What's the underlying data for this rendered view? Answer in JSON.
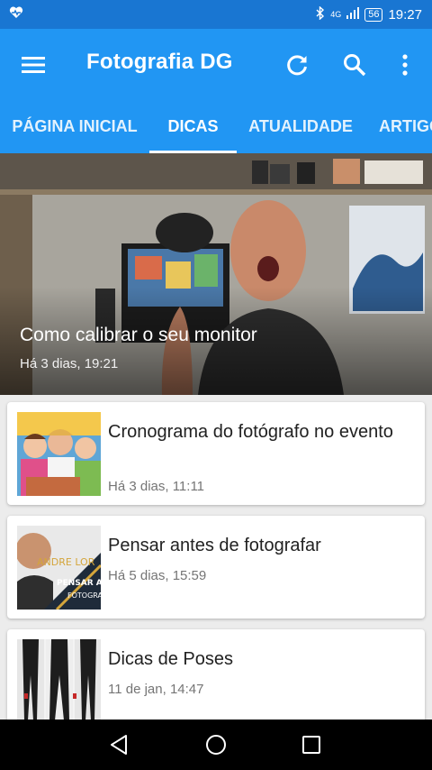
{
  "status_bar": {
    "network": "4G",
    "battery": "56",
    "time": "19:27"
  },
  "app_bar": {
    "title": "Fotografia DG"
  },
  "tabs": [
    {
      "label": "PÁGINA INICIAL",
      "active": false
    },
    {
      "label": "DICAS",
      "active": true
    },
    {
      "label": "ATUALIDADE",
      "active": false
    },
    {
      "label": "ARTIGOS",
      "active": false
    }
  ],
  "featured": {
    "title": "Como calibrar o seu monitor",
    "date": "Há 3 dias, 19:21"
  },
  "articles": [
    {
      "title": "Cronograma do fotógrafo no evento",
      "date": "Há 3 dias, 11:11"
    },
    {
      "title": "Pensar antes de fotografar",
      "date": "Há 5 dias, 15:59"
    },
    {
      "title": "Dicas de Poses",
      "date": "11 de jan, 14:47"
    }
  ],
  "thumb_texts": {
    "pensar_brand": "ANDRE LOR",
    "pensar_line1": "PENSAR ANT",
    "pensar_line2": "FOTOGRA"
  },
  "colors": {
    "status_bar": "#1976d2",
    "app_bar": "#2196f3",
    "nav_bar": "#000000"
  }
}
